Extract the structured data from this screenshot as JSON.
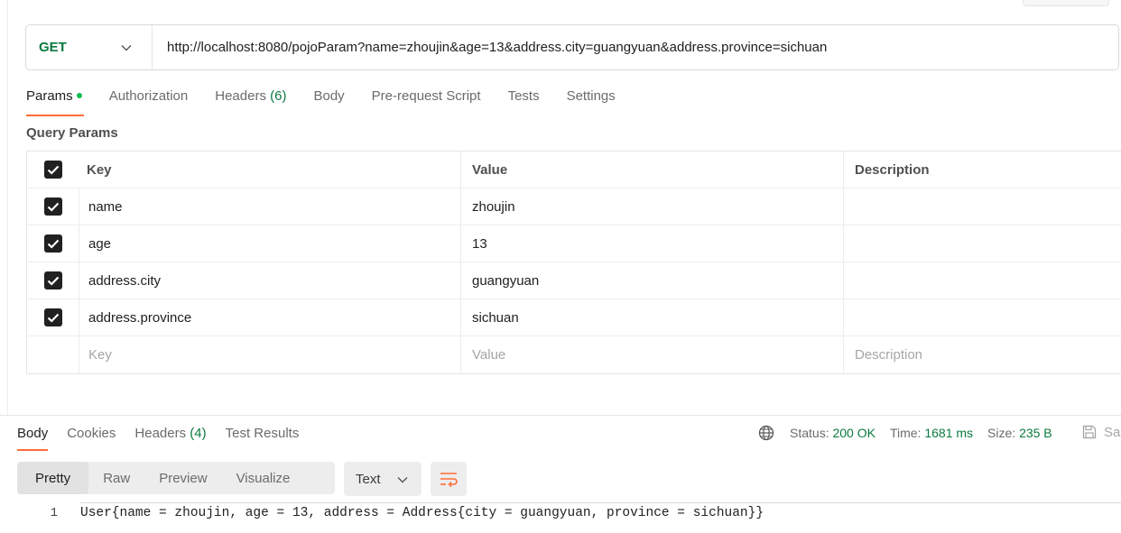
{
  "request": {
    "method": "GET",
    "url": "http://localhost:8080/pojoParam?name=zhoujin&age=13&address.city=guangyuan&address.province=sichuan"
  },
  "request_tabs": {
    "params": "Params",
    "authorization": "Authorization",
    "headers": "Headers",
    "headers_count": "(6)",
    "body": "Body",
    "prerequest": "Pre-request Script",
    "tests": "Tests",
    "settings": "Settings"
  },
  "query_params": {
    "title": "Query Params",
    "columns": {
      "key": "Key",
      "value": "Value",
      "description": "Description"
    },
    "rows": [
      {
        "key": "name",
        "value": "zhoujin"
      },
      {
        "key": "age",
        "value": "13"
      },
      {
        "key": "address.city",
        "value": "guangyuan"
      },
      {
        "key": "address.province",
        "value": "sichuan"
      }
    ],
    "placeholders": {
      "key": "Key",
      "value": "Value",
      "description": "Description"
    }
  },
  "response_tabs": {
    "body": "Body",
    "cookies": "Cookies",
    "headers": "Headers",
    "headers_count": "(4)",
    "test_results": "Test Results"
  },
  "response_status": {
    "status_label": "Status:",
    "status_value": "200 OK",
    "time_label": "Time:",
    "time_value": "1681 ms",
    "size_label": "Size:",
    "size_value": "235 B",
    "save_label": "Sa"
  },
  "response_view": {
    "modes": [
      "Pretty",
      "Raw",
      "Preview",
      "Visualize"
    ],
    "format": "Text"
  },
  "response_body": {
    "line_number": "1",
    "text": "User{name = zhoujin, age = 13, address = Address{city = guangyuan, province = sichuan}}"
  },
  "colors": {
    "accent": "#ff6c37",
    "method_green": "#0b7a3e",
    "status_green": "#0cbb52"
  }
}
